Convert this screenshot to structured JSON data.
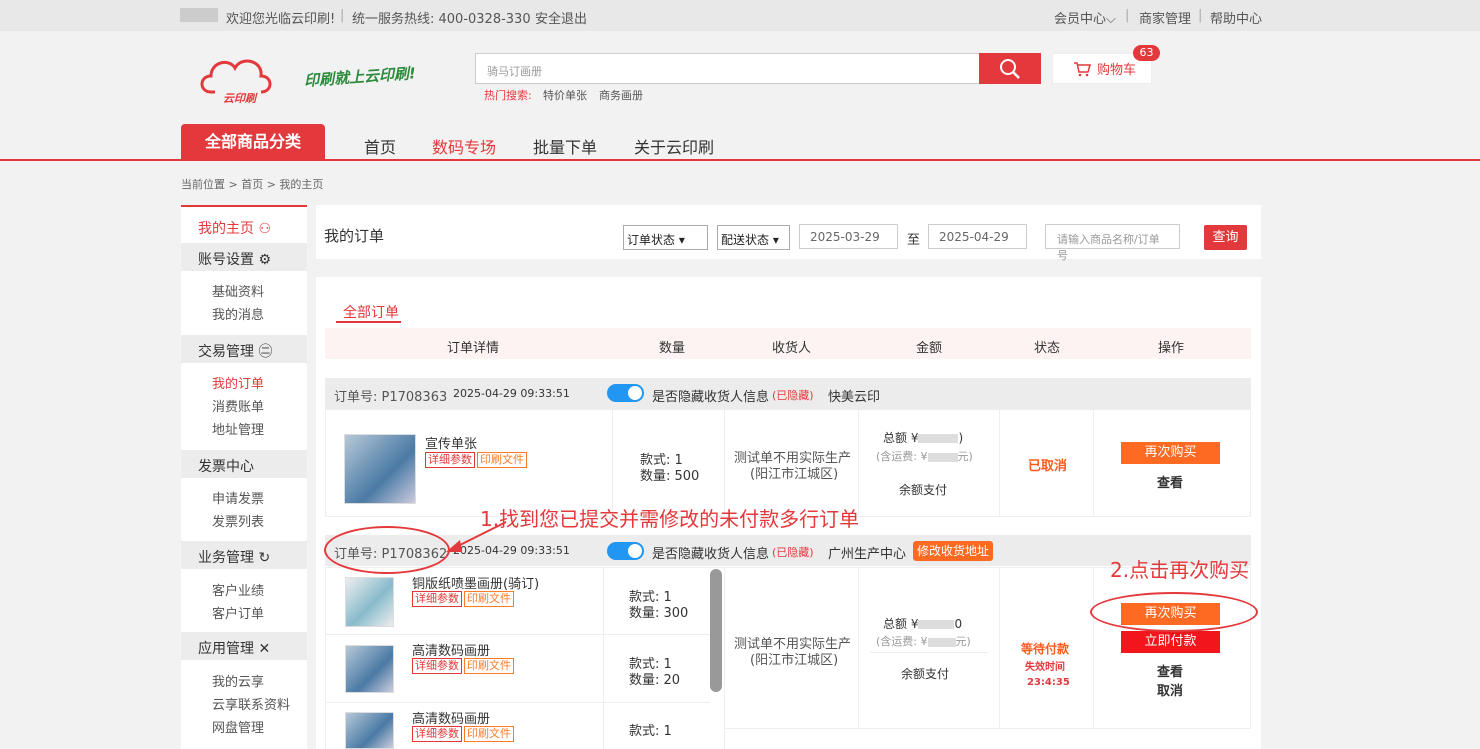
{
  "topbar": {
    "welcome": "欢迎您光临云印刷!",
    "sep": "|",
    "hotline": "统一服务热线: 400-0328-330",
    "logout": "安全退出",
    "member_center": "会员中心",
    "merchant": "商家管理",
    "help": "帮助中心"
  },
  "header": {
    "logo_text": "云印刷",
    "slogan": "印刷就上云印刷!",
    "search_placeholder": "骑马订画册",
    "hot_label": "热门搜索:",
    "hot1": "特价单张",
    "hot2": "商务画册",
    "cart_label": "购物车",
    "cart_count": "63"
  },
  "nav": {
    "all": "全部商品分类",
    "home": "首页",
    "digital": "数码专场",
    "batch": "批量下单",
    "about": "关于云印刷"
  },
  "breadcrumb": "当前位置 > 首页 > 我的主页",
  "sidebar": {
    "home": "我的主页",
    "account": "账号设置",
    "basic": "基础资料",
    "messages": "我的消息",
    "trade": "交易管理",
    "orders": "我的订单",
    "bills": "消费账单",
    "address": "地址管理",
    "invoice": "发票中心",
    "apply_invoice": "申请发票",
    "invoice_list": "发票列表",
    "business": "业务管理",
    "performance": "客户业绩",
    "client_orders": "客户订单",
    "apps": "应用管理",
    "cloud": "我的云享",
    "cloud_contacts": "云享联系资料",
    "disk": "网盘管理"
  },
  "filter": {
    "title": "我的订单",
    "order_status": "订单状态",
    "delivery_status": "配送状态",
    "date_from": "2025-03-29",
    "to": "至",
    "date_to": "2025-04-29",
    "search_placeholder": "请输入商品名称/订单号",
    "query": "查询"
  },
  "tabs": {
    "all": "全部订单"
  },
  "columns": [
    "订单详情",
    "数量",
    "收货人",
    "金额",
    "状态",
    "操作"
  ],
  "orders": [
    {
      "order_no": "订单号: P1708363",
      "time": "2025-04-29 09:33:51",
      "hide_info": "是否隐藏收货人信息",
      "hidden": "(已隐藏)",
      "shop": "快美云印",
      "items": [
        {
          "name": "宣传单张",
          "tag1": "详细参数",
          "tag2": "印刷文件",
          "style": "款式: 1",
          "qty": "数量: 500"
        }
      ],
      "receiver": "测试单不用实际生产",
      "region": "(阳江市江城区)",
      "total": "总额 ¥",
      "total_tail": ")",
      "freight": "(含运费:",
      "freight_tail": "元)",
      "pay_method": "余额支付",
      "status": "已取消",
      "btn_rebuy": "再次购买",
      "view": "查看"
    },
    {
      "order_no": "订单号: P1708362",
      "time": "2025-04-29 09:33:51",
      "hide_info": "是否隐藏收货人信息",
      "hidden": "(已隐藏)",
      "shop": "广州生产中心",
      "edit_address": "修改收货地址",
      "items": [
        {
          "name": "铜版纸喷墨画册(骑订)",
          "tag1": "详细参数",
          "tag2": "印刷文件",
          "style": "款式: 1",
          "qty": "数量: 300"
        },
        {
          "name": "高清数码画册",
          "tag1": "详细参数",
          "tag2": "印刷文件",
          "style": "款式: 1",
          "qty": "数量: 20"
        },
        {
          "name": "高清数码画册",
          "tag1": "详细参数",
          "tag2": "印刷文件",
          "style": "款式: 1",
          "qty": ""
        }
      ],
      "receiver": "测试单不用实际生产",
      "region": "(阳江市江城区)",
      "total": "总额 ¥",
      "total_tail": "0",
      "freight": "(含运费:",
      "freight_tail": "元)",
      "pay_method": "余额支付",
      "status": "等待付款",
      "expire_label": "失效时间",
      "countdown": "23:4:35",
      "btn_rebuy": "再次购买",
      "btn_pay": "立即付款",
      "view": "查看",
      "cancel": "取消"
    }
  ],
  "annotations": {
    "step1": "1.找到您已提交并需修改的未付款多行订单",
    "step2": "2.点击再次购买"
  },
  "colors": {
    "brand_red": "#e4393c",
    "orange": "#ff7b27",
    "toggle_blue": "#2196f3"
  }
}
